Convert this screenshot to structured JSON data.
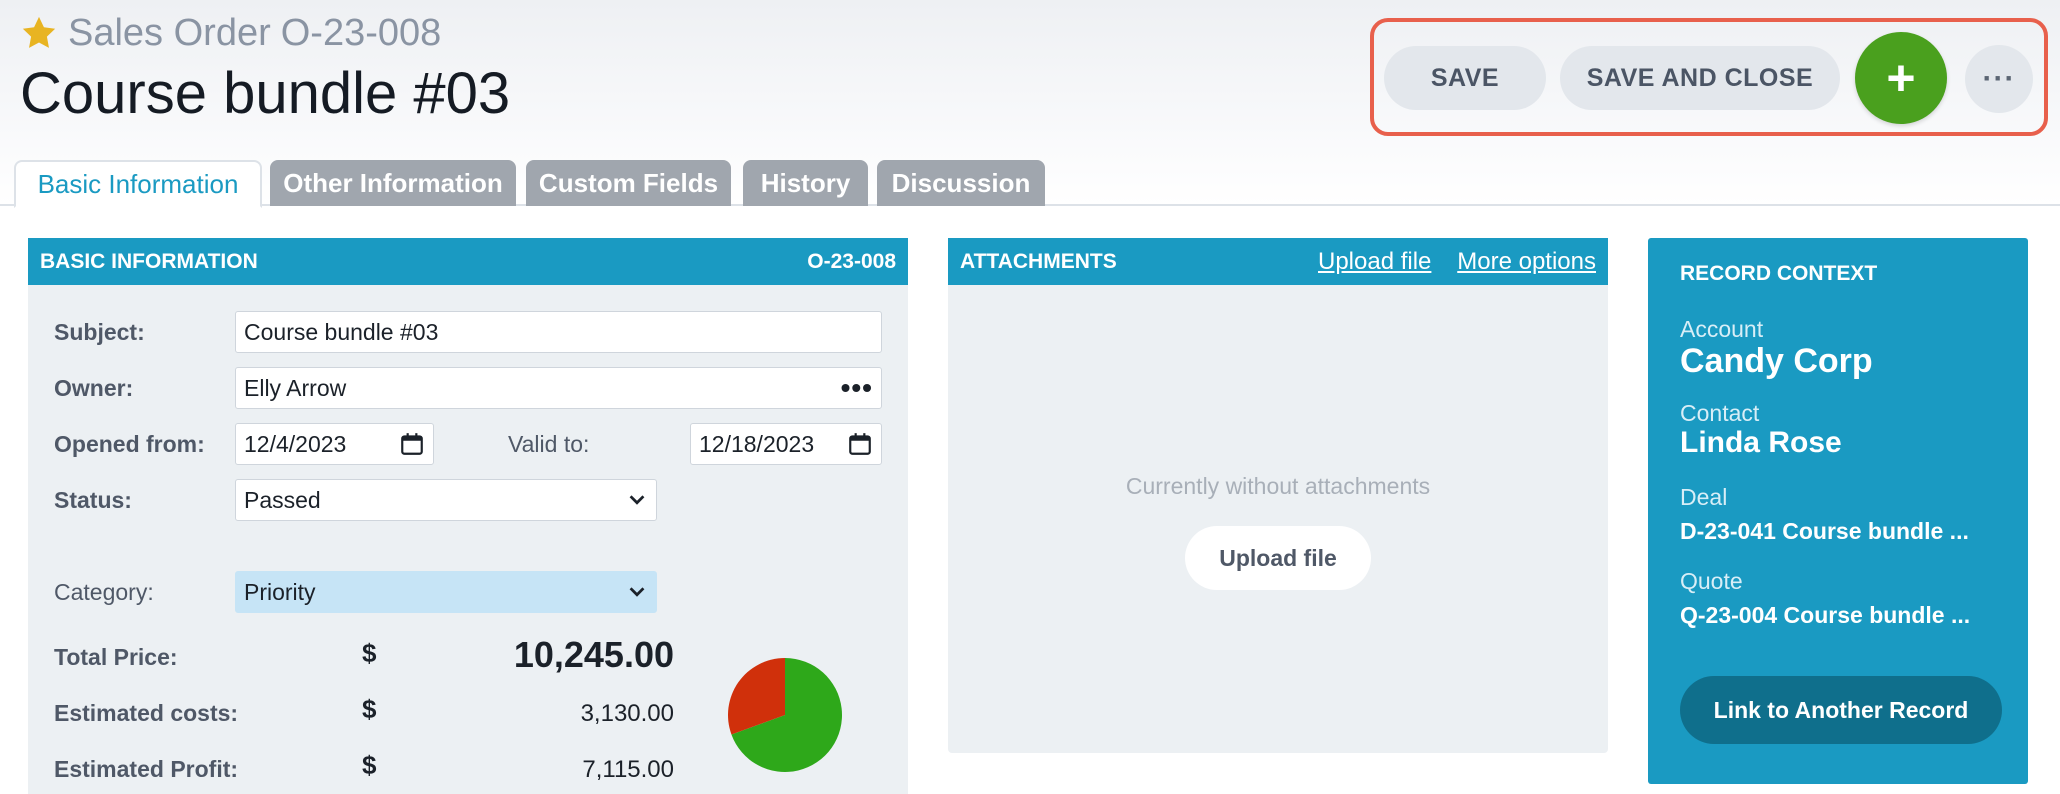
{
  "header": {
    "record_type": "Sales Order",
    "record_number": "O-23-008",
    "title": "Course bundle #03",
    "star_color": "#e8b422"
  },
  "actions": {
    "save": "SAVE",
    "save_and_close": "SAVE AND CLOSE",
    "add": "+",
    "more": "···",
    "add_color": "#4aa01e",
    "highlight_color": "#e8604c"
  },
  "tabs": [
    {
      "label": "Basic Information",
      "active": true
    },
    {
      "label": "Other Information"
    },
    {
      "label": "Custom Fields"
    },
    {
      "label": "History"
    },
    {
      "label": "Discussion"
    }
  ],
  "basic": {
    "heading": "BASIC INFORMATION",
    "number": "O-23-008",
    "subject_label": "Subject:",
    "subject_value": "Course bundle #03",
    "owner_label": "Owner:",
    "owner_value": "Elly Arrow",
    "opened_label": "Opened from:",
    "opened_value": "12/4/2023",
    "valid_label": "Valid to:",
    "valid_value": "12/18/2023",
    "status_label": "Status:",
    "status_value": "Passed",
    "category_label": "Category:",
    "category_value": "Priority",
    "total_label": "Total Price:",
    "total_value": "10,245.00",
    "costs_label": "Estimated costs:",
    "costs_value": "3,130.00",
    "profit_label": "Estimated Profit:",
    "profit_value": "7,115.00",
    "currency": "$",
    "chart": {
      "slices": [
        {
          "name": "Estimated costs",
          "value": 3130,
          "color": "#d0300b"
        },
        {
          "name": "Estimated Profit",
          "value": 7115,
          "color": "#2ea81a"
        }
      ]
    }
  },
  "attachments": {
    "heading": "ATTACHMENTS",
    "upload_link": "Upload file",
    "more_link": "More options",
    "empty_text": "Currently without attachments",
    "upload_button": "Upload file"
  },
  "context": {
    "heading": "RECORD CONTEXT",
    "account_label": "Account",
    "account_value": "Candy Corp",
    "contact_label": "Contact",
    "contact_value": "Linda Rose",
    "deal_label": "Deal",
    "deal_value": "D-23-041 Course bundle ...",
    "quote_label": "Quote",
    "quote_value": "Q-23-004 Course bundle ...",
    "link_button": "Link to Another Record"
  }
}
